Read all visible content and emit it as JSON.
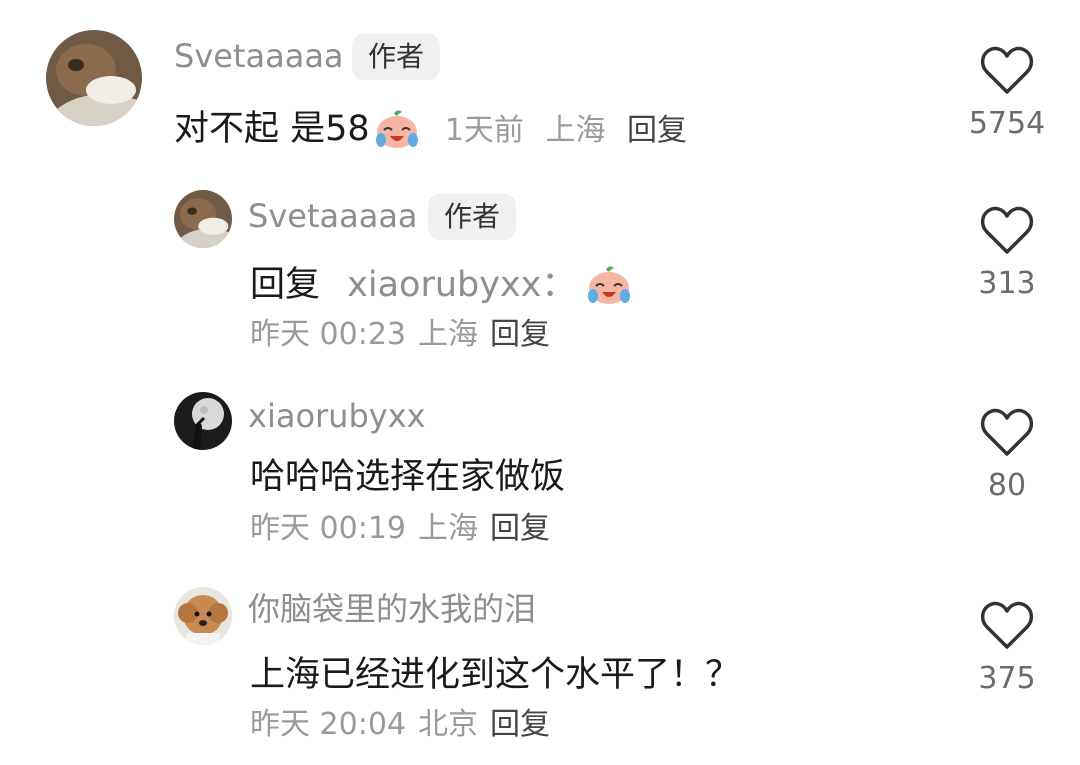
{
  "comments": [
    {
      "author": "Svetaaaaa",
      "badge": "作者",
      "text": "对不起 是58",
      "emoji": "crying-laughing-emoji",
      "time": "1天前",
      "location": "上海",
      "reply_label": "回复",
      "likes": "5754"
    },
    {
      "author": "Svetaaaaa",
      "badge": "作者",
      "reply_prefix": "回复",
      "reply_to": "xiaorubyxx：",
      "emoji": "crying-laughing-emoji",
      "time": "昨天 00:23",
      "location": "上海",
      "reply_label": "回复",
      "likes": "313"
    },
    {
      "author": "xiaorubyxx",
      "text": "哈哈哈选择在家做饭",
      "time": "昨天 00:19",
      "location": "上海",
      "reply_label": "回复",
      "likes": "80"
    },
    {
      "author": "你脑袋里的水我的泪",
      "text": "上海已经进化到这个水平了！？",
      "time": "昨天 20:04",
      "location": "北京",
      "reply_label": "回复",
      "likes": "375"
    }
  ],
  "colors": {
    "author": "#8e8e8e",
    "content": "#1a1a1a",
    "meta": "#9a9a9a",
    "badge_bg": "#f0f0f0",
    "heart_stroke": "#333333"
  }
}
